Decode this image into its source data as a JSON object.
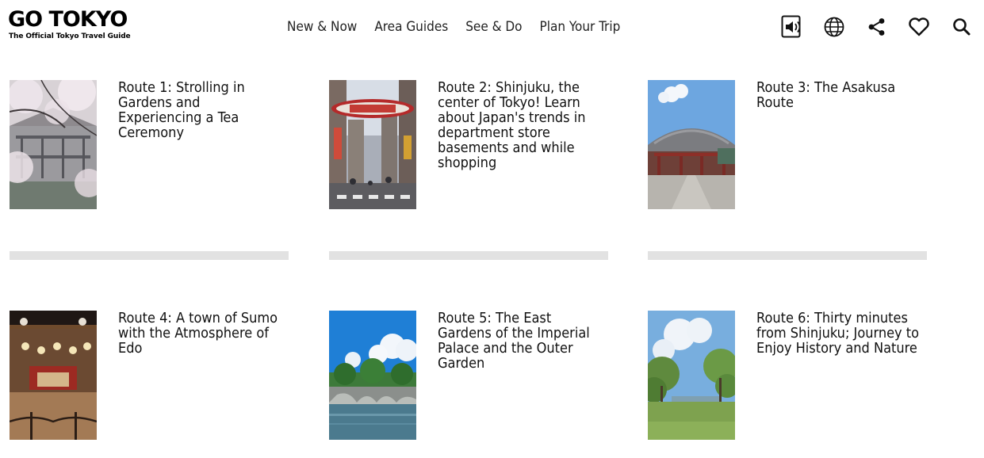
{
  "logo": {
    "name": "GO TOKYO",
    "tagline": "The Official Tokyo Travel Guide"
  },
  "nav": {
    "items": [
      {
        "label": "New & Now"
      },
      {
        "label": "Area Guides"
      },
      {
        "label": "See & Do"
      },
      {
        "label": "Plan Your Trip"
      }
    ]
  },
  "header_icons": [
    "speaker-icon",
    "globe-icon",
    "share-icon",
    "heart-icon",
    "search-icon"
  ],
  "routes": [
    {
      "title": "Route 1: Strolling in Gardens and Experiencing a Tea Ceremony"
    },
    {
      "title": "Route 2: Shinjuku, the center of Tokyo! Learn about Japan's trends in department store basements and while shopping"
    },
    {
      "title": "Route 3: The Asakusa Route"
    },
    {
      "title": "Route 4: A town of Sumo with the Atmosphere of Edo"
    },
    {
      "title": "Route 5: The East Gardens of the Imperial Palace and the Outer Garden"
    },
    {
      "title": "Route 6: Thirty minutes from Shinjuku; Journey to Enjoy History and Nature"
    }
  ],
  "colors": {
    "text": "#111111",
    "divider": "#e2e2e2",
    "background": "#ffffff"
  }
}
